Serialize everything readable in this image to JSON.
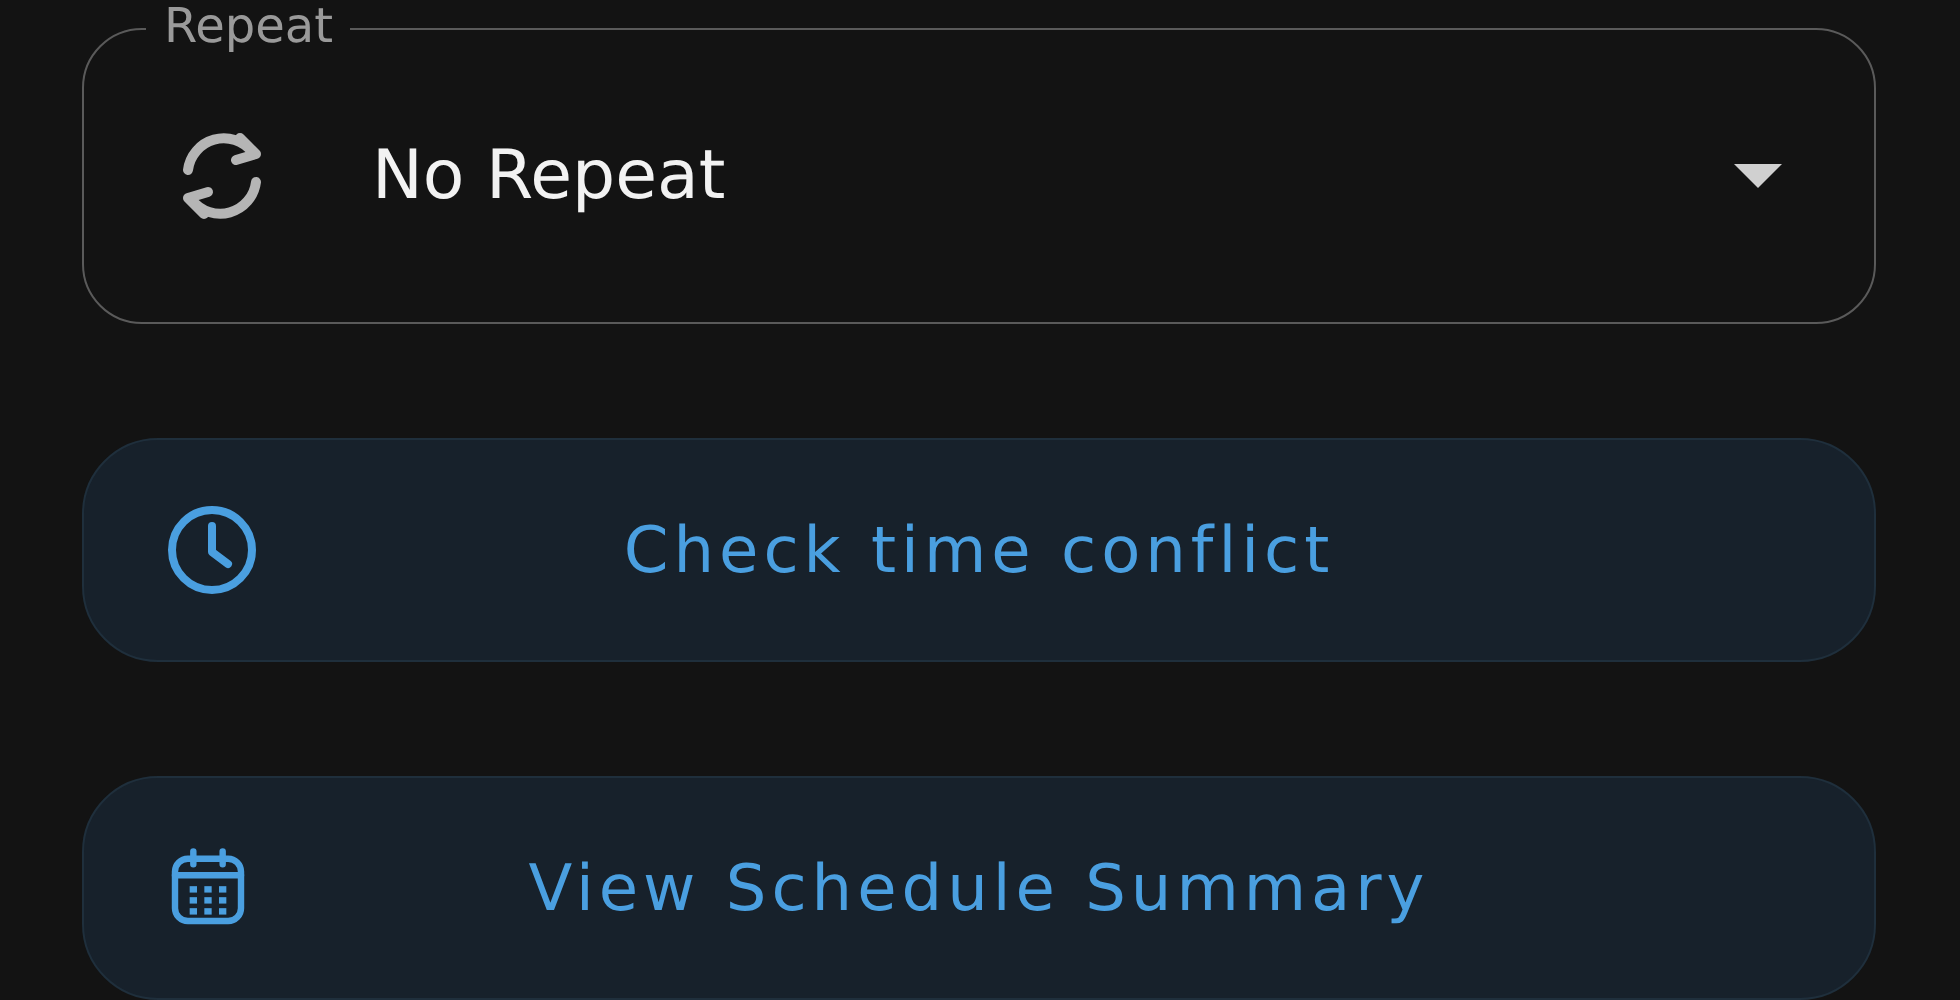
{
  "repeat": {
    "label": "Repeat",
    "value": "No Repeat"
  },
  "buttons": [
    {
      "kind": "clock",
      "label": "Check time conflict"
    },
    {
      "kind": "calendar",
      "label": "View Schedule Summary"
    }
  ]
}
